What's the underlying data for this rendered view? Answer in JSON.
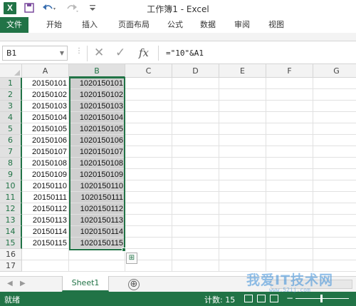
{
  "window": {
    "title": "工作簿1 - Excel",
    "app_icon": "excel-icon",
    "accent_color": "#217346"
  },
  "quick_access": [
    "save-icon",
    "undo-icon",
    "redo-icon",
    "customize-icon"
  ],
  "ribbon": {
    "tabs": [
      "文件",
      "开始",
      "插入",
      "页面布局",
      "公式",
      "数据",
      "审阅",
      "视图"
    ]
  },
  "formula_bar": {
    "name_box": "B1",
    "cancel_icon": "✕",
    "enter_icon": "✓",
    "fx_label": "fx",
    "formula": "=\"10\"&A1"
  },
  "sheet": {
    "columns": [
      "A",
      "B",
      "C",
      "D",
      "E",
      "F",
      "G"
    ],
    "selected_column": "B",
    "rows": [
      {
        "num": "1",
        "a": "20150101",
        "b": "1020150101"
      },
      {
        "num": "2",
        "a": "20150102",
        "b": "1020150102"
      },
      {
        "num": "3",
        "a": "20150103",
        "b": "1020150103"
      },
      {
        "num": "4",
        "a": "20150104",
        "b": "1020150104"
      },
      {
        "num": "5",
        "a": "20150105",
        "b": "1020150105"
      },
      {
        "num": "6",
        "a": "20150106",
        "b": "1020150106"
      },
      {
        "num": "7",
        "a": "20150107",
        "b": "1020150107"
      },
      {
        "num": "8",
        "a": "20150108",
        "b": "1020150108"
      },
      {
        "num": "9",
        "a": "20150109",
        "b": "1020150109"
      },
      {
        "num": "10",
        "a": "20150110",
        "b": "1020150110"
      },
      {
        "num": "11",
        "a": "20150111",
        "b": "1020150111"
      },
      {
        "num": "12",
        "a": "20150112",
        "b": "1020150112"
      },
      {
        "num": "13",
        "a": "20150113",
        "b": "1020150113"
      },
      {
        "num": "14",
        "a": "20150114",
        "b": "1020150114"
      },
      {
        "num": "15",
        "a": "20150115",
        "b": "1020150115"
      },
      {
        "num": "16",
        "a": "",
        "b": ""
      },
      {
        "num": "17",
        "a": "",
        "b": ""
      }
    ]
  },
  "sheet_tabs": {
    "active": "Sheet1",
    "add_icon": "⊕"
  },
  "status_bar": {
    "ready": "就绪",
    "count": "计数: 15"
  },
  "watermark": {
    "text": "我爱IT技术网",
    "url": "www.52ij.com"
  }
}
